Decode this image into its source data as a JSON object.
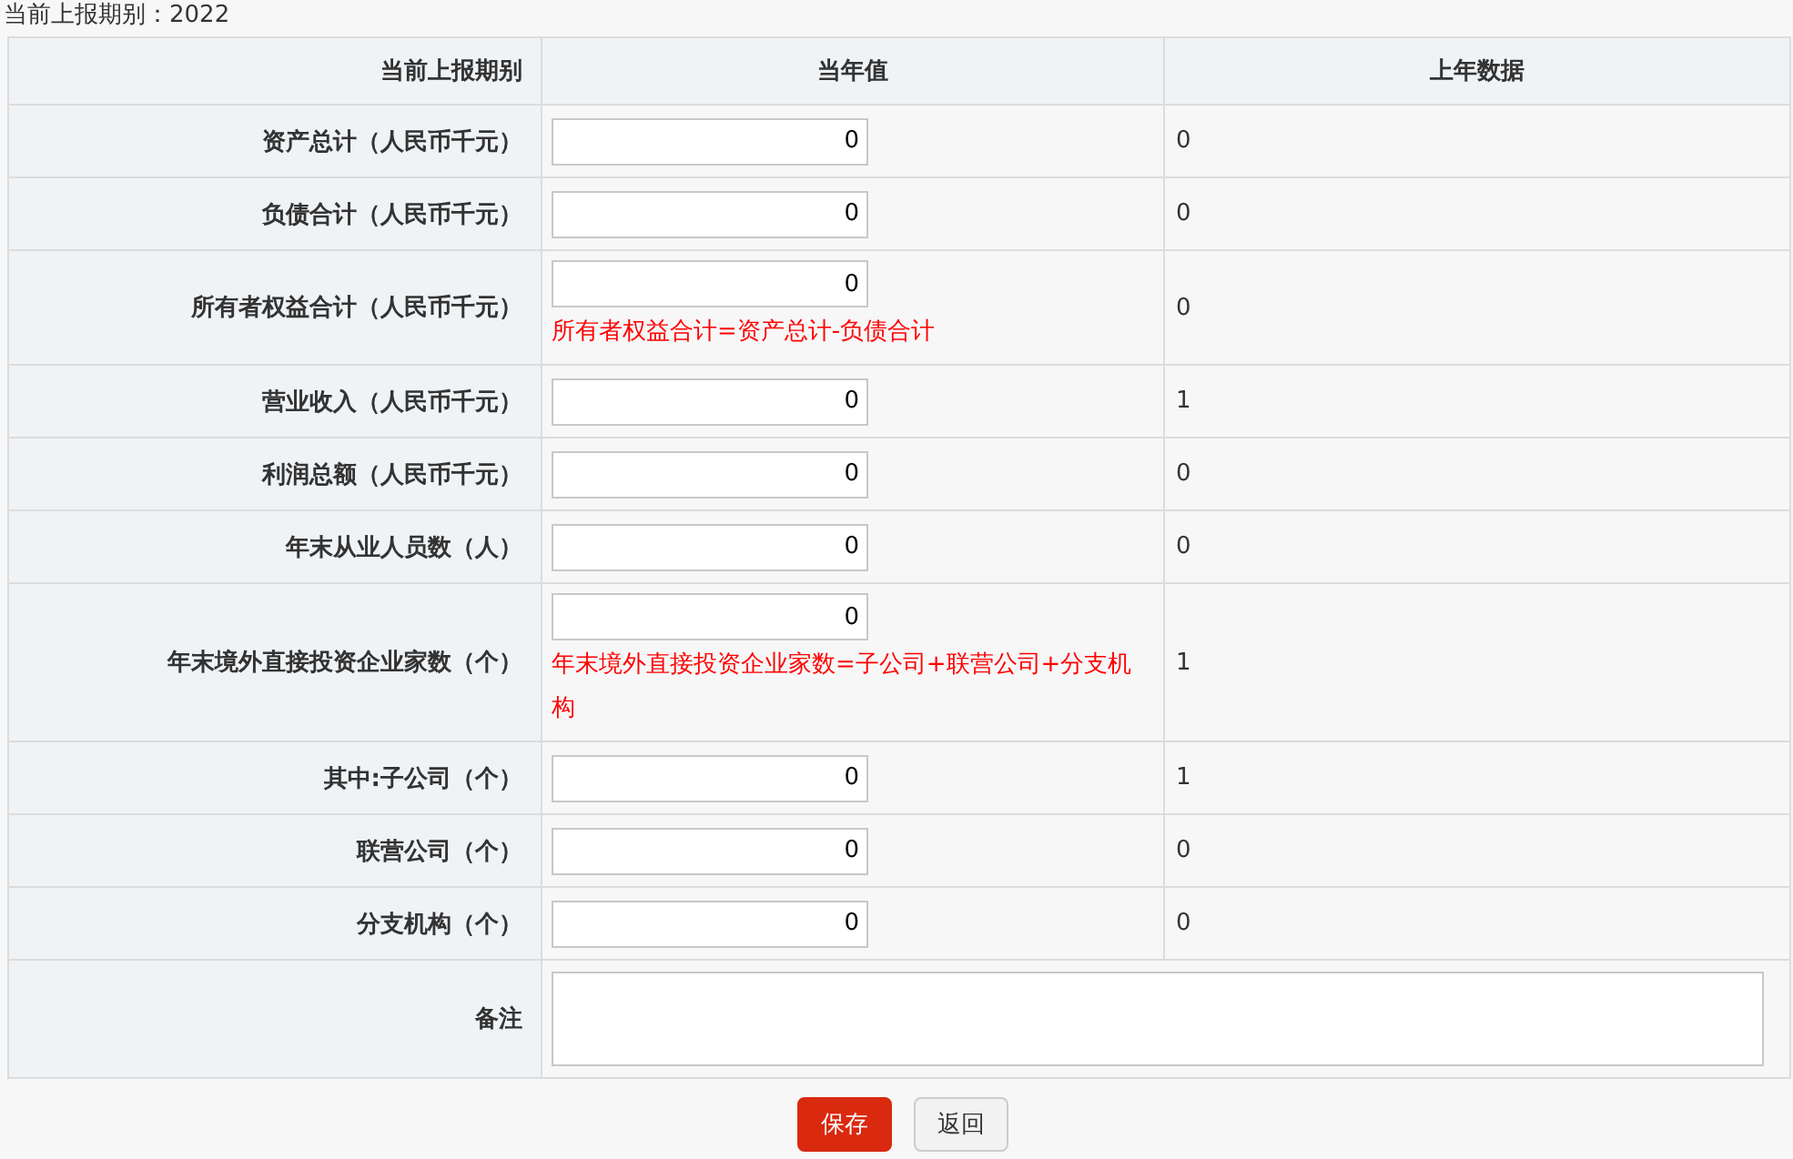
{
  "period_label": "当前上报期别：2022",
  "table": {
    "columns": [
      "当前上报期别",
      "当年值",
      "上年数据"
    ],
    "rows": [
      {
        "label": "资产总计（人民币千元）",
        "value": "0",
        "previous": "0"
      },
      {
        "label": "负债合计（人民币千元）",
        "value": "0",
        "previous": "0"
      },
      {
        "label": "所有者权益合计（人民币千元）",
        "value": "0",
        "note": "所有者权益合计=资产总计-负债合计",
        "previous": "0"
      },
      {
        "label": "营业收入（人民币千元）",
        "value": "0",
        "previous": "1"
      },
      {
        "label": "利润总额（人民币千元）",
        "value": "0",
        "previous": "0"
      },
      {
        "label": "年末从业人员数（人）",
        "value": "0",
        "previous": "0"
      },
      {
        "label": "年末境外直接投资企业家数（个）",
        "value": "0",
        "note": "年末境外直接投资企业家数=子公司+联营公司+分支机构",
        "previous": "1"
      },
      {
        "label": "其中:子公司（个）",
        "value": "0",
        "previous": "1"
      },
      {
        "label": "联营公司（个）",
        "value": "0",
        "previous": "0"
      },
      {
        "label": "分支机构（个）",
        "value": "0",
        "previous": "0"
      }
    ],
    "remarks": {
      "label": "备注"
    }
  },
  "buttons": [
    {
      "label": "保存",
      "kind": "primary"
    },
    {
      "label": "返回",
      "kind": "secondary"
    }
  ]
}
